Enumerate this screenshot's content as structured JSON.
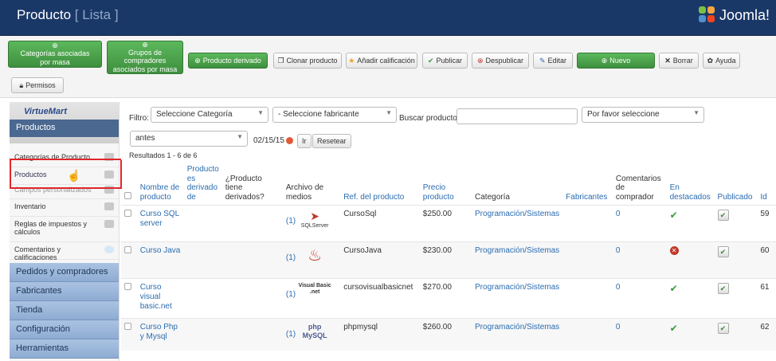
{
  "header": {
    "title": "Producto",
    "subtitle": "[ Lista ]",
    "brand": "Joomla!"
  },
  "toolbar": {
    "mass_categories": "Categorías asociadas por masa",
    "mass_buyers": "Grupos de compradores asociados por masa",
    "derived": "Producto derivado",
    "clone": "Clonar producto",
    "rating": "Añadir calificación",
    "publish": "Publicar",
    "unpublish": "Despublicar",
    "edit": "Editar",
    "new": "Nuevo",
    "delete": "Borrar",
    "help": "Ayuda",
    "permissions": "Permisos"
  },
  "sidebar": {
    "brand": "VirtueMart",
    "section": "Productos",
    "items": [
      {
        "label": "Categorías de Producto"
      },
      {
        "label": "Productos"
      },
      {
        "label": "Campos personalizados"
      },
      {
        "label": "Inventario"
      },
      {
        "label": "Reglas de impuestos y cálculos"
      },
      {
        "label": "Comentarios y calificaciones"
      }
    ],
    "groups": [
      "Pedidos y compradores",
      "Fabricantes",
      "Tienda",
      "Configuración",
      "Herramientas"
    ]
  },
  "filters": {
    "filter_label": "Filtro:",
    "category": "Seleccione Categoría",
    "manufacturer": "- Seleccione fabricante",
    "search_label": "Buscar producto",
    "search_value": "",
    "select": "Por favor seleccione",
    "date_mode": "antes",
    "date": "02/15/15",
    "go": "Ir",
    "reset": "Resetear",
    "results": "Resultados 1 - 6 de 6"
  },
  "columns": {
    "name": "Nombre de producto",
    "derived_of": "Producto es derivado de",
    "has_derived": "¿Producto tiene derivados?",
    "media": "Archivo de medios",
    "ref": "Ref. del producto",
    "price": "Precio producto",
    "category": "Categoría",
    "manufacturers": "Fabricantes",
    "comments": "Comentarios de comprador",
    "featured": "En destacados",
    "published": "Publicado",
    "id": "Id"
  },
  "rows": [
    {
      "name": "Curso SQL server",
      "media_count": "(1)",
      "media_label": "SQLServer",
      "ref": "CursoSql",
      "price": "$250.00",
      "category": "Programación/Sistemas",
      "comments": "0",
      "featured": true,
      "id": "59"
    },
    {
      "name": "Curso Java",
      "media_count": "(1)",
      "media_label": "Java",
      "ref": "CursoJava",
      "price": "$230.00",
      "category": "Programación/Sistemas",
      "comments": "0",
      "featured": false,
      "id": "60"
    },
    {
      "name": "Curso visual basic.net",
      "media_count": "(1)",
      "media_label": "Visual Basic .net",
      "ref": "cursovisualbasicnet",
      "price": "$270.00",
      "category": "Programación/Sistemas",
      "comments": "0",
      "featured": true,
      "id": "61"
    },
    {
      "name": "Curso Php y Mysql",
      "media_count": "(1)",
      "media_label": "php MySQL",
      "ref": "phpmysql",
      "price": "$260.00",
      "category": "Programación/Sistemas",
      "comments": "0",
      "featured": true,
      "id": "62"
    }
  ],
  "colors": {
    "header_bg": "#1a3867",
    "green_button": "#4cae4c",
    "link": "#2b6cb0",
    "highlight": "#e0262b"
  }
}
